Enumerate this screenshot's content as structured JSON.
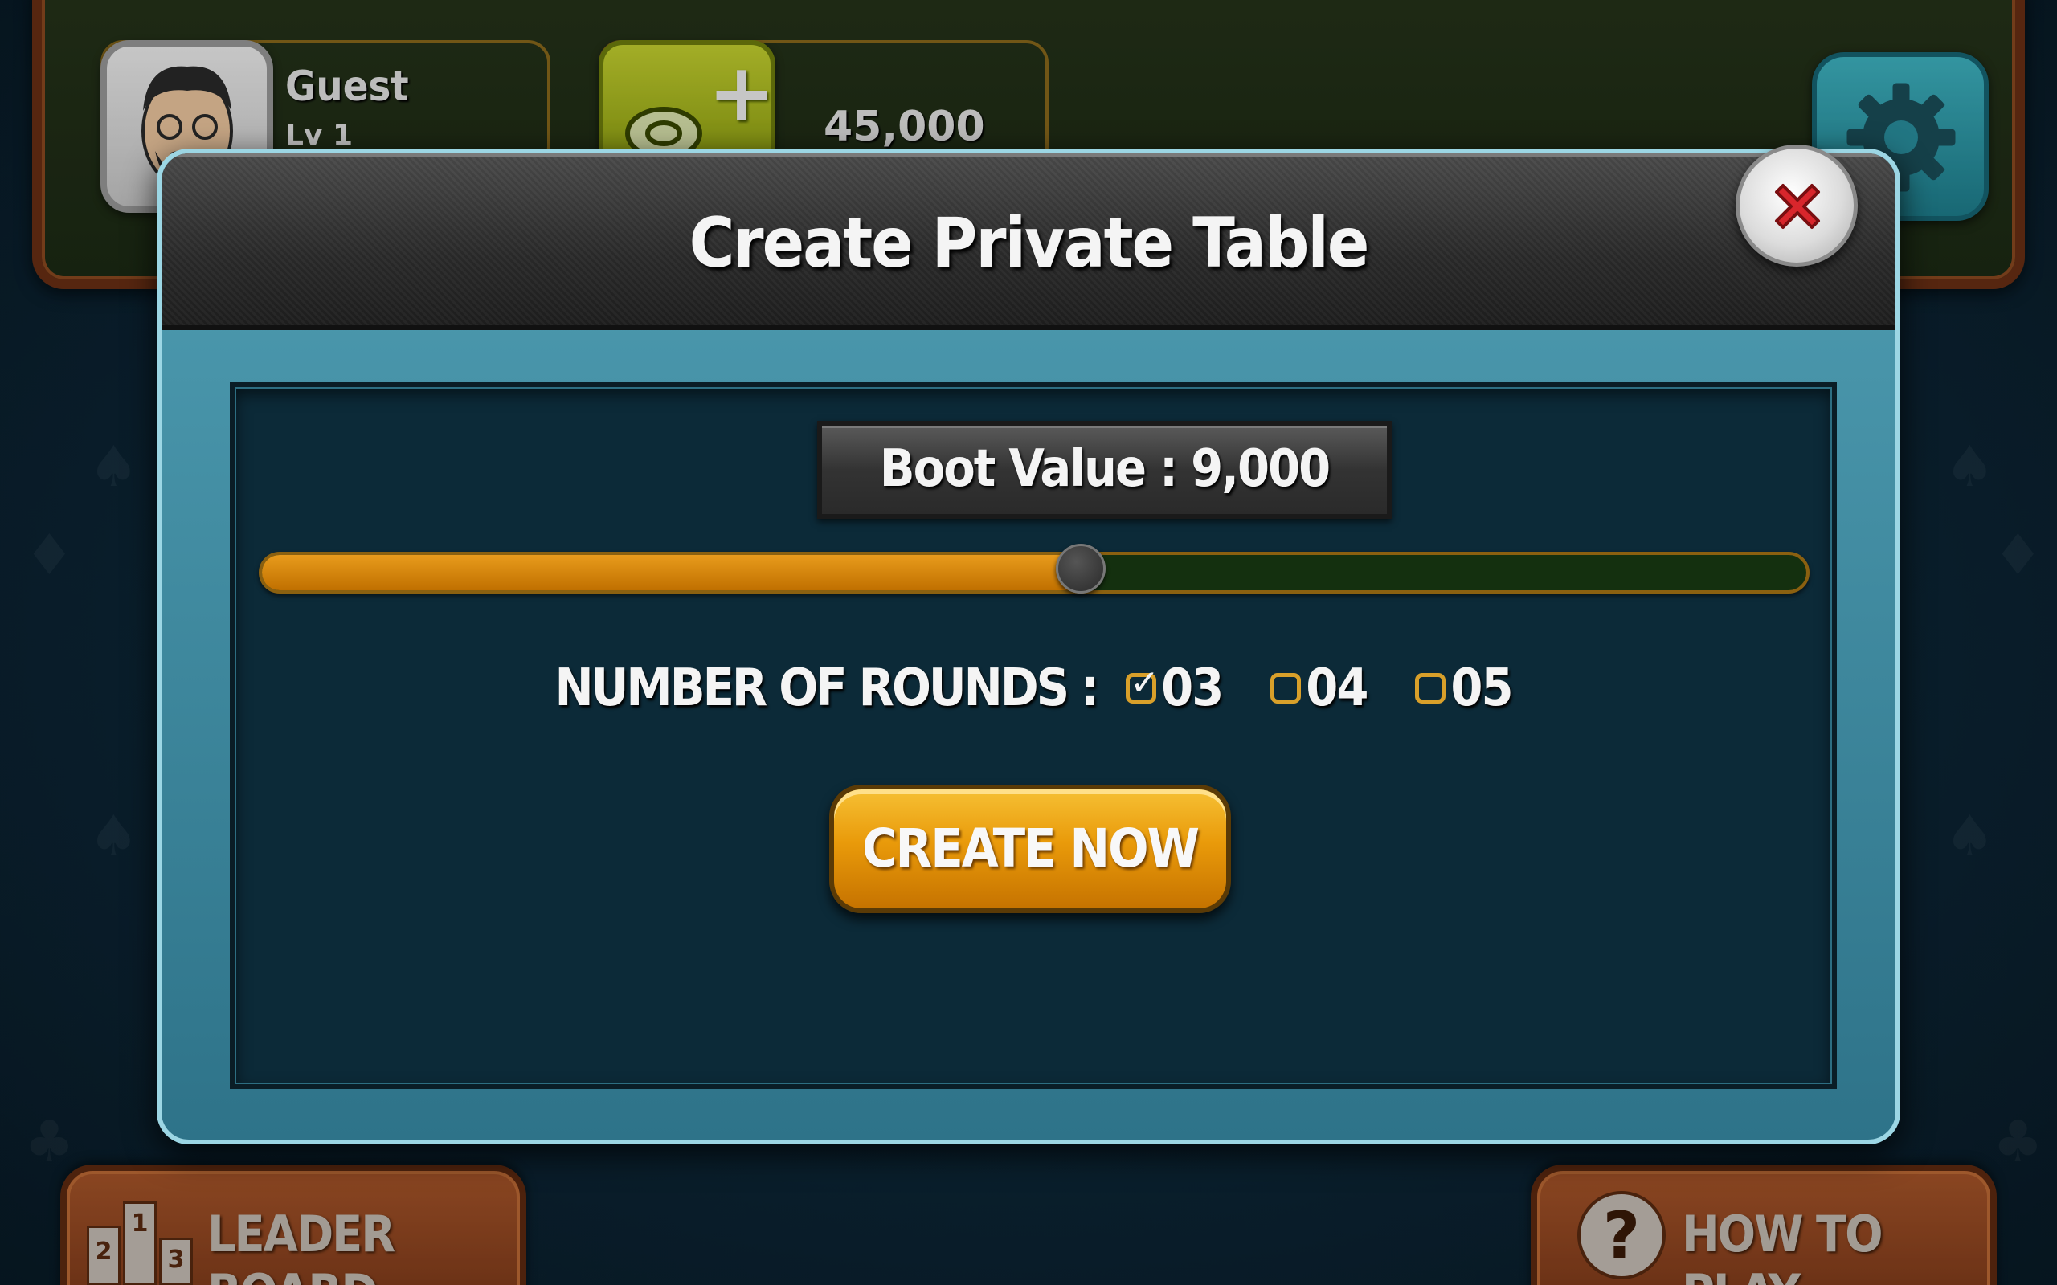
{
  "profile": {
    "name": "Guest",
    "level": "Lv 1"
  },
  "chips": {
    "amount": "45,000"
  },
  "modal": {
    "title": "Create Private Table",
    "boot_value_label": "Boot Value : 9,000",
    "boot_slider": {
      "value_fraction": 0.53
    },
    "rounds": {
      "label": "NUMBER OF ROUNDS :",
      "options": [
        {
          "value": "03",
          "checked": true
        },
        {
          "value": "04",
          "checked": false
        },
        {
          "value": "05",
          "checked": false
        }
      ]
    },
    "create_button": "CREATE NOW"
  },
  "bottom": {
    "leaderboard_label": "LEADER BOARD",
    "leaderboard_podium": [
      "2",
      "1",
      "3"
    ],
    "howto_label": "HOW TO PLAY"
  },
  "colors": {
    "accent_orange": "#e99a0a",
    "panel_teal": "#4f9db2",
    "close_red": "#d8262c"
  },
  "icons": {
    "close": "close-icon",
    "settings": "gear-icon",
    "add_chips": "plus-icon",
    "leaderboard": "podium-icon",
    "help": "question-icon"
  }
}
